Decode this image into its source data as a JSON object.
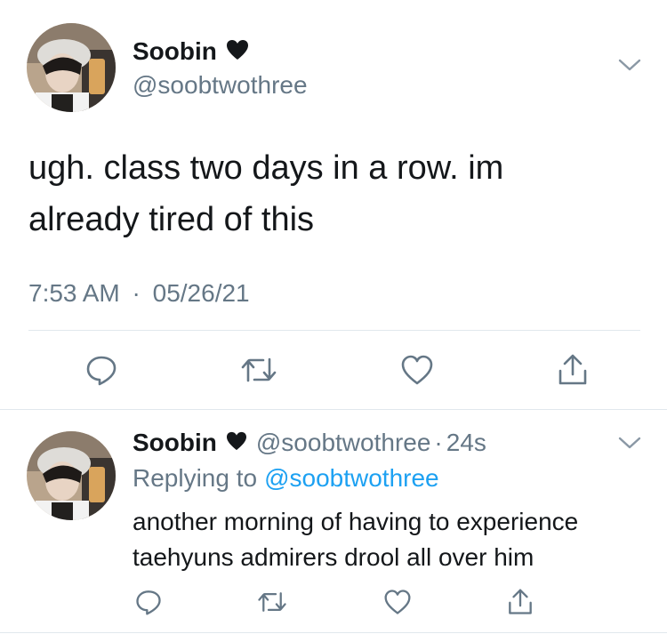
{
  "main_tweet": {
    "display_name": "Soobin",
    "handle": "@soobtwothree",
    "text_lines": [
      "ugh. class two days in a row. im",
      "already tired of this"
    ],
    "time": "7:53 AM",
    "separator": "·",
    "date": "05/26/21",
    "icons": {
      "verified": "heart-icon",
      "menu": "chevron-down-icon",
      "reply": "reply-icon",
      "retweet": "retweet-icon",
      "like": "like-icon",
      "share": "share-icon"
    }
  },
  "reply_tweet": {
    "display_name": "Soobin",
    "handle": "@soobtwothree",
    "separator": "·",
    "age": "24s",
    "replying_to_label": "Replying to",
    "replying_to_handle": "@soobtwothree",
    "text_lines": [
      "another morning of having to experience",
      "taehyuns admirers drool all over him"
    ]
  },
  "colors": {
    "text": "#14171a",
    "secondary": "#657786",
    "link": "#1da1f2",
    "divider": "#e1e8ed"
  }
}
